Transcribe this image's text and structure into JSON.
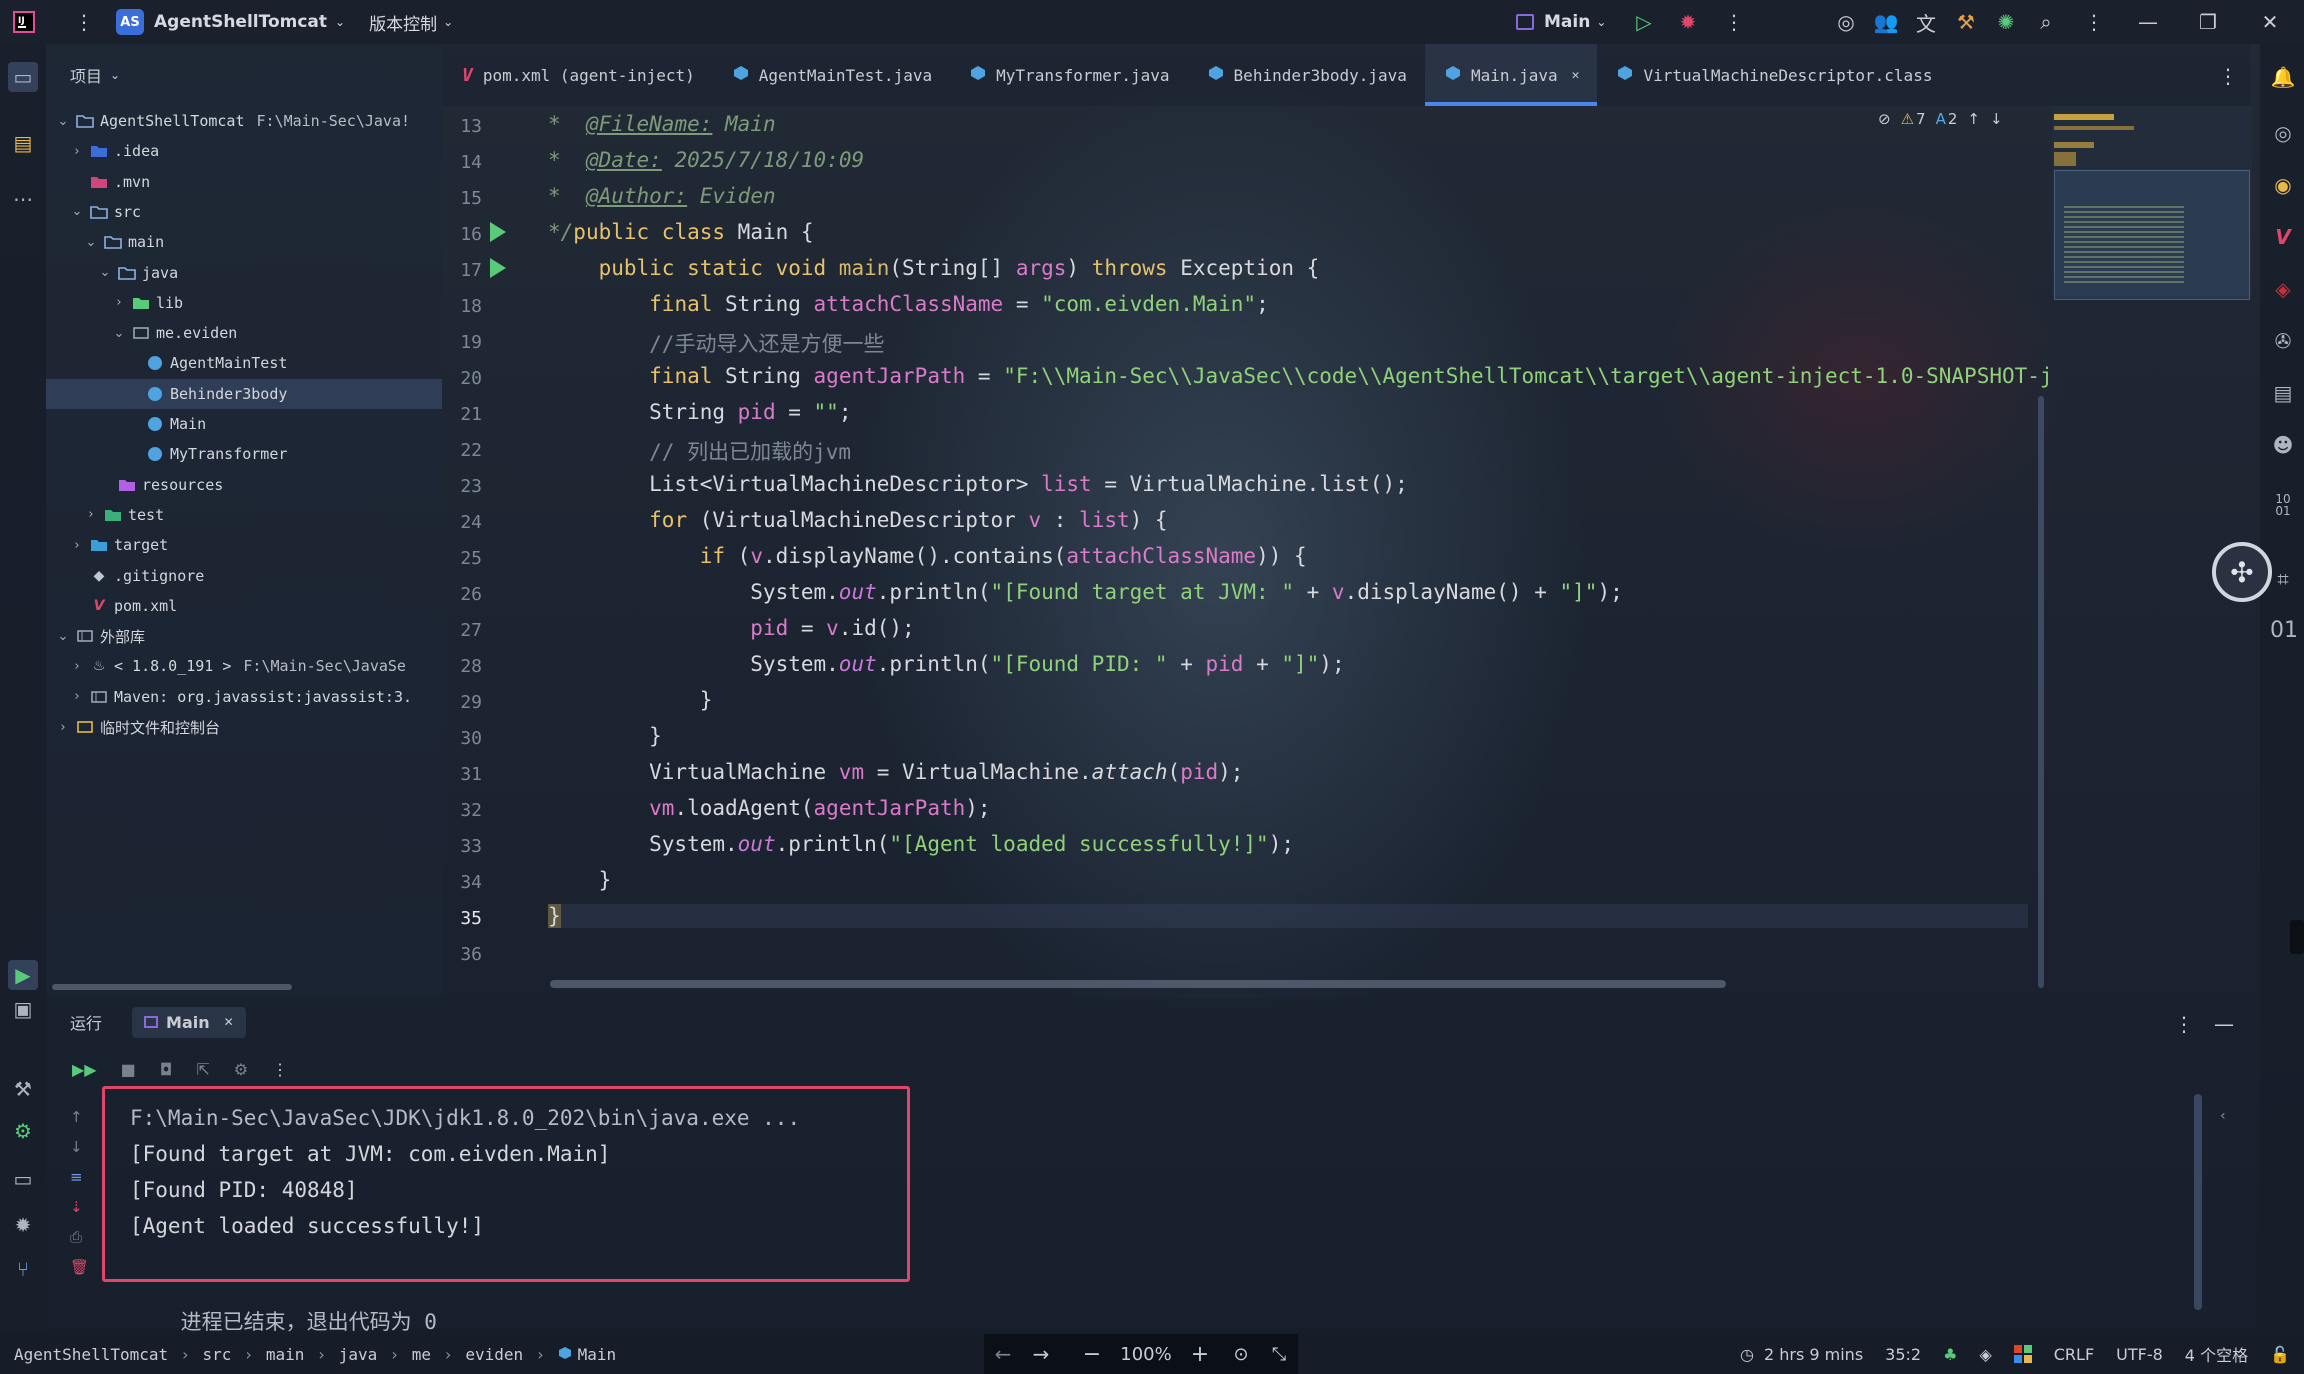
{
  "titlebar": {
    "project_badge": "AS",
    "project_name": "AgentShellTomcat",
    "vcs_label": "版本控制",
    "run_config": "Main"
  },
  "project_panel": {
    "header": "项目",
    "tree": [
      {
        "label": "AgentShellTomcat",
        "path": "F:\\Main-Sec\\Java!",
        "depth": 0,
        "icon": "folder-icon"
      },
      {
        "label": ".idea",
        "depth": 1,
        "icon": "folder-icon"
      },
      {
        "label": ".mvn",
        "depth": 1,
        "icon": "folder-icon"
      },
      {
        "label": "src",
        "depth": 1,
        "icon": "folder-icon"
      },
      {
        "label": "main",
        "depth": 2,
        "icon": "folder-icon"
      },
      {
        "label": "java",
        "depth": 3,
        "icon": "folder-icon"
      },
      {
        "label": "lib",
        "depth": 4,
        "icon": "folder-icon"
      },
      {
        "label": "me.eviden",
        "depth": 4,
        "icon": "package-icon"
      },
      {
        "label": "AgentMainTest",
        "depth": 5,
        "icon": "class-icon"
      },
      {
        "label": "Behinder3body",
        "depth": 5,
        "icon": "class-icon"
      },
      {
        "label": "Main",
        "depth": 5,
        "icon": "class-icon"
      },
      {
        "label": "MyTransformer",
        "depth": 5,
        "icon": "class-icon"
      },
      {
        "label": "resources",
        "depth": 3,
        "icon": "folder-icon"
      },
      {
        "label": "test",
        "depth": 2,
        "icon": "folder-icon"
      },
      {
        "label": "target",
        "depth": 1,
        "icon": "folder-icon"
      },
      {
        "label": ".gitignore",
        "depth": 1,
        "icon": "git-icon"
      },
      {
        "label": "pom.xml",
        "depth": 1,
        "icon": "maven-icon"
      },
      {
        "label": "外部库",
        "depth": 0,
        "icon": "library-icon"
      },
      {
        "label": "< 1.8.0_191 >",
        "path": "F:\\Main-Sec\\JavaSe",
        "depth": 1,
        "icon": "jdk-icon"
      },
      {
        "label": "Maven: org.javassist:javassist:3.",
        "depth": 1,
        "icon": "library-icon"
      },
      {
        "label": "临时文件和控制台",
        "depth": 0,
        "icon": "scratch-icon"
      }
    ]
  },
  "tabs": [
    {
      "label": "pom.xml (agent-inject)",
      "icon": "maven-icon"
    },
    {
      "label": "AgentMainTest.java",
      "icon": "class-icon"
    },
    {
      "label": "MyTransformer.java",
      "icon": "class-icon"
    },
    {
      "label": "Behinder3body.java",
      "icon": "class-icon"
    },
    {
      "label": "Main.java",
      "icon": "class-icon",
      "active": true
    },
    {
      "label": "VirtualMachineDescriptor.class",
      "icon": "class-icon"
    }
  ],
  "inspections": {
    "warnings": "7",
    "typos": "2"
  },
  "editor": {
    "line_numbers": [
      "13",
      "14",
      "15",
      "16",
      "17",
      "18",
      "19",
      "20",
      "21",
      "22",
      "23",
      "24",
      "25",
      "26",
      "27",
      "28",
      "29",
      "30",
      "31",
      "32",
      "33",
      "34",
      "35",
      "36"
    ],
    "javadoc": {
      "filename_tag": "@FileName:",
      "filename": "Main",
      "date_tag": "@Date:",
      "date": "2025/7/18/10:09",
      "author_tag": "@Author:",
      "author": "Eviden"
    },
    "strings": {
      "attach_class": "\"com.eivden.Main\"",
      "jar_path": "\"F:\\\\Main-Sec\\\\JavaSec\\\\code\\\\AgentShellTomcat\\\\target\\\\agent-inject-1.0-SNAPSHOT-j",
      "empty": "\"\"",
      "found_target": "\"[Found target at JVM: \"",
      "close_bracket": "\"]\"",
      "found_pid": "\"[Found PID: \"",
      "loaded": "\"[Agent loaded successfully!]\""
    },
    "comments": {
      "manual_import": "//手动导入还是方便一些",
      "list_jvm": "// 列出已加载的jvm"
    }
  },
  "bottom_panel": {
    "tab_run": "运行",
    "tab_main": "Main",
    "console": [
      "F:\\Main-Sec\\JavaSec\\JDK\\jdk1.8.0_202\\bin\\java.exe ...",
      "[Found target at JVM: com.eivden.Main]",
      "[Found PID: 40848]",
      "[Agent loaded successfully!]"
    ],
    "exit_msg_prefix": "进程已结束，退出代码为 ",
    "exit_code": "0"
  },
  "statusbar": {
    "breadcrumb": [
      "AgentShellTomcat",
      "src",
      "main",
      "java",
      "me",
      "eviden",
      "Main"
    ],
    "zoom": "100%",
    "time": "2 hrs 9 mins",
    "position": "35:2",
    "line_sep": "CRLF",
    "encoding": "UTF-8",
    "indent": "4 个空格"
  },
  "right_strip_counter": "01",
  "right_strip_counter2_top": "10",
  "right_strip_counter2_bottom": "01"
}
